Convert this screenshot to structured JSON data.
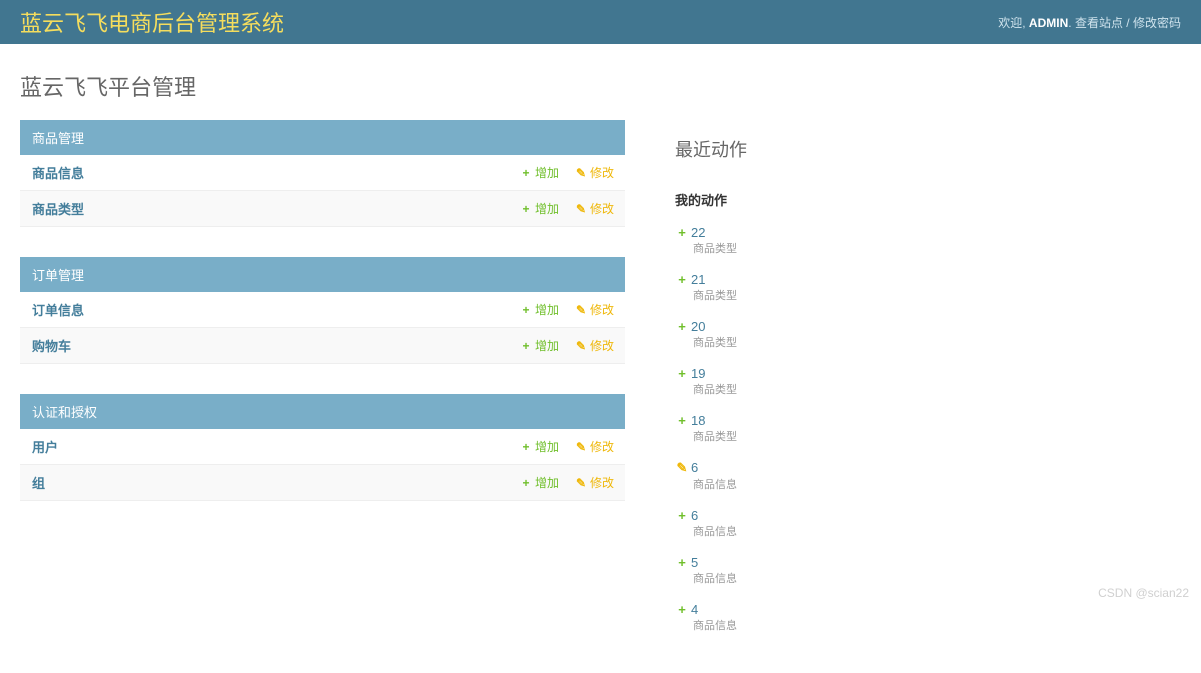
{
  "header": {
    "brand": "蓝云飞飞电商后台管理系统",
    "welcome": "欢迎,",
    "username": "ADMIN",
    "dot": ".",
    "view_site": "查看站点",
    "sep": "/",
    "change_password": "修改密码"
  },
  "page_title": "蓝云飞飞平台管理",
  "labels": {
    "add": "增加",
    "change": "修改"
  },
  "apps": [
    {
      "name": "商品管理",
      "models": [
        {
          "name": "商品信息"
        },
        {
          "name": "商品类型"
        }
      ]
    },
    {
      "name": "订单管理",
      "models": [
        {
          "name": "订单信息"
        },
        {
          "name": "购物车"
        }
      ]
    },
    {
      "name": "认证和授权",
      "models": [
        {
          "name": "用户"
        },
        {
          "name": "组"
        }
      ]
    }
  ],
  "recent": {
    "title": "最近动作",
    "subtitle": "我的动作",
    "items": [
      {
        "icon": "add",
        "label": "22",
        "type": "商品类型"
      },
      {
        "icon": "add",
        "label": "21",
        "type": "商品类型"
      },
      {
        "icon": "add",
        "label": "20",
        "type": "商品类型"
      },
      {
        "icon": "add",
        "label": "19",
        "type": "商品类型"
      },
      {
        "icon": "add",
        "label": "18",
        "type": "商品类型"
      },
      {
        "icon": "change",
        "label": "6",
        "type": "商品信息"
      },
      {
        "icon": "add",
        "label": "6",
        "type": "商品信息"
      },
      {
        "icon": "add",
        "label": "5",
        "type": "商品信息"
      },
      {
        "icon": "add",
        "label": "4",
        "type": "商品信息"
      }
    ]
  },
  "watermark": "CSDN @scian22"
}
